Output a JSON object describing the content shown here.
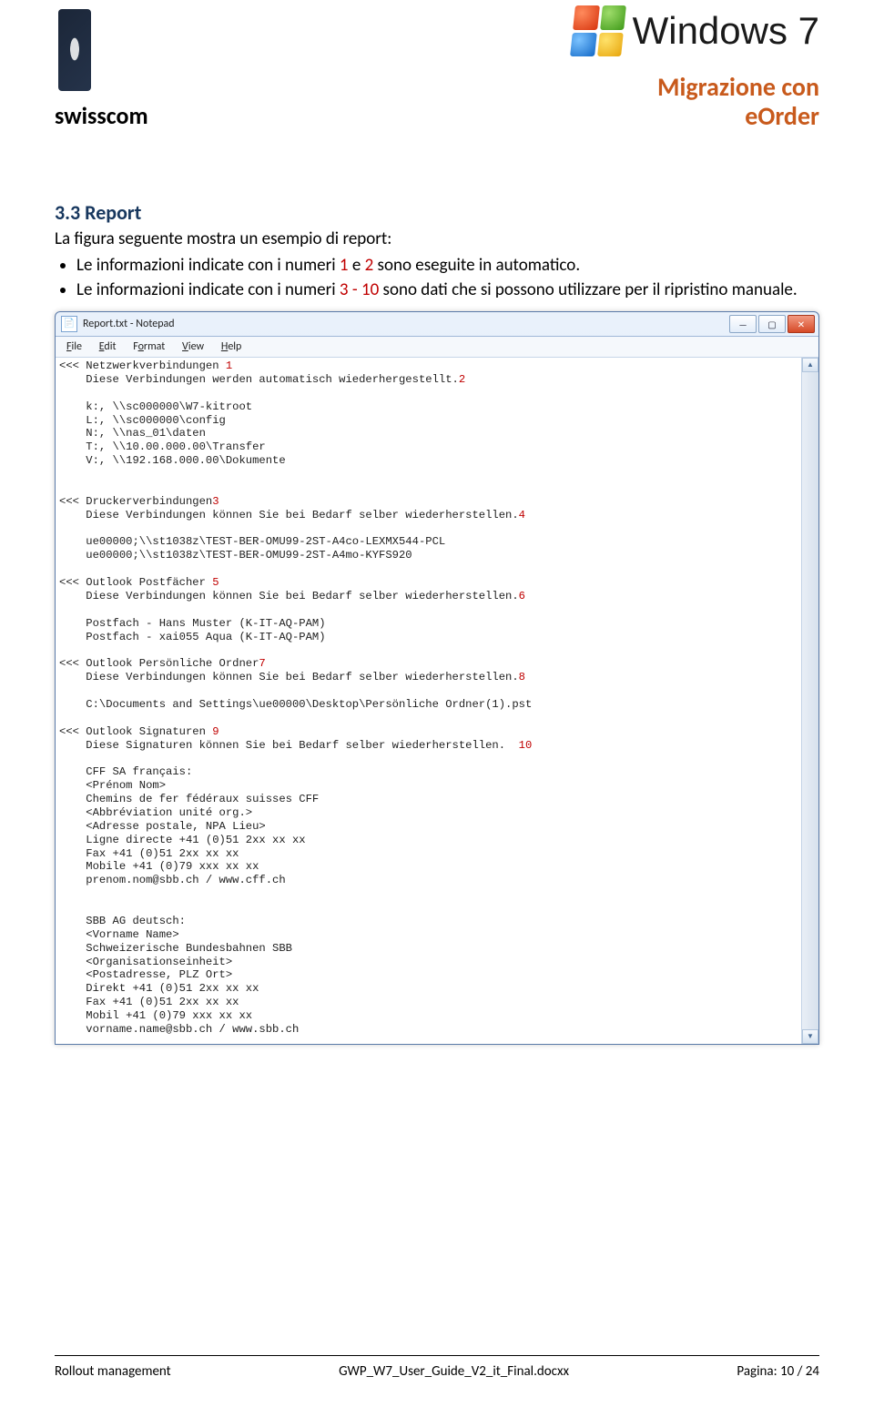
{
  "header": {
    "swisscom_word": "swisscom",
    "windows_word": "Windows 7",
    "title_line1": "Migrazione con",
    "title_line2": "eOrder"
  },
  "section": {
    "heading": "3.3 Report",
    "intro": "La figura seguente mostra un esempio di report:",
    "bullet1_pre": "Le informazioni indicate con i numeri ",
    "bullet1_n1": "1",
    "bullet1_mid": " e ",
    "bullet1_n2": "2",
    "bullet1_post": " sono eseguite in automatico.",
    "bullet2_pre": "Le informazioni indicate con i numeri ",
    "bullet2_range": "3 - 10",
    "bullet2_post": " sono dati che si possono utilizzare per il ripristino manuale."
  },
  "notepad": {
    "title_main": "Report.txt - Notepad",
    "title_dim": "",
    "menus": {
      "file": "File",
      "edit": "Edit",
      "format": "Format",
      "view": "View",
      "help": "Help"
    },
    "win_btn_min": "—",
    "win_btn_max": "▢",
    "win_btn_close": "✕",
    "scroll_up": "▲",
    "scroll_down": "▼",
    "lines": [
      {
        "t": "<<< Netzwerkverbindungen ",
        "r": "1"
      },
      {
        "t": "    Diese Verbindungen werden automatisch wiederhergestellt.",
        "r": "2"
      },
      {
        "t": ""
      },
      {
        "t": "    k:, \\\\sc000000\\W7-kitroot"
      },
      {
        "t": "    L:, \\\\sc000000\\config"
      },
      {
        "t": "    N:, \\\\nas_01\\daten"
      },
      {
        "t": "    T:, \\\\10.00.000.00\\Transfer"
      },
      {
        "t": "    V:, \\\\192.168.000.00\\Dokumente"
      },
      {
        "t": ""
      },
      {
        "t": ""
      },
      {
        "t": "<<< Druckerverbindungen",
        "r": "3"
      },
      {
        "t": "    Diese Verbindungen können Sie bei Bedarf selber wiederherstellen.",
        "r": "4"
      },
      {
        "t": ""
      },
      {
        "t": "    ue00000;\\\\st1038z\\TEST-BER-OMU99-2ST-A4co-LEXMX544-PCL"
      },
      {
        "t": "    ue00000;\\\\st1038z\\TEST-BER-OMU99-2ST-A4mo-KYFS920"
      },
      {
        "t": ""
      },
      {
        "t": "<<< Outlook Postfächer ",
        "r": "5"
      },
      {
        "t": "    Diese Verbindungen können Sie bei Bedarf selber wiederherstellen.",
        "r": "6"
      },
      {
        "t": ""
      },
      {
        "t": "    Postfach - Hans Muster (K-IT-AQ-PAM)"
      },
      {
        "t": "    Postfach - xai055 Aqua (K-IT-AQ-PAM)"
      },
      {
        "t": ""
      },
      {
        "t": "<<< Outlook Persönliche Ordner",
        "r": "7"
      },
      {
        "t": "    Diese Verbindungen können Sie bei Bedarf selber wiederherstellen.",
        "r": "8"
      },
      {
        "t": ""
      },
      {
        "t": "    C:\\Documents and Settings\\ue00000\\Desktop\\Persönliche Ordner(1).pst"
      },
      {
        "t": ""
      },
      {
        "t": "<<< Outlook Signaturen ",
        "r": "9"
      },
      {
        "t": "    Diese Signaturen können Sie bei Bedarf selber wiederherstellen.  ",
        "r": "10"
      },
      {
        "t": ""
      },
      {
        "t": "    CFF SA français:"
      },
      {
        "t": "    <Prénom Nom>"
      },
      {
        "t": "    Chemins de fer fédéraux suisses CFF"
      },
      {
        "t": "    <Abbréviation unité org.>"
      },
      {
        "t": "    <Adresse postale, NPA Lieu>"
      },
      {
        "t": "    Ligne directe +41 (0)51 2xx xx xx"
      },
      {
        "t": "    Fax +41 (0)51 2xx xx xx"
      },
      {
        "t": "    Mobile +41 (0)79 xxx xx xx"
      },
      {
        "t": "    prenom.nom@sbb.ch / www.cff.ch"
      },
      {
        "t": ""
      },
      {
        "t": ""
      },
      {
        "t": "    SBB AG deutsch:"
      },
      {
        "t": "    <Vorname Name>"
      },
      {
        "t": "    Schweizerische Bundesbahnen SBB"
      },
      {
        "t": "    <Organisationseinheit>"
      },
      {
        "t": "    <Postadresse, PLZ Ort>"
      },
      {
        "t": "    Direkt +41 (0)51 2xx xx xx"
      },
      {
        "t": "    Fax +41 (0)51 2xx xx xx"
      },
      {
        "t": "    Mobil +41 (0)79 xxx xx xx"
      },
      {
        "t": "    vorname.name@sbb.ch / www.sbb.ch"
      }
    ]
  },
  "footer": {
    "left": "Rollout management",
    "center": "GWP_W7_User_Guide_V2_it_Final.docxx",
    "right": "Pagina: 10 / 24"
  }
}
